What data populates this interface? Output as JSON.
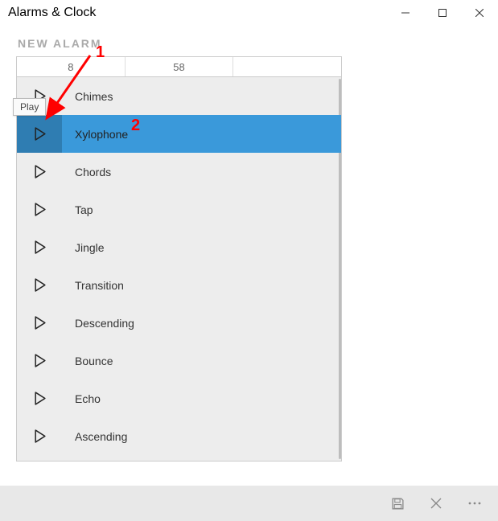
{
  "titlebar": {
    "title": "Alarms & Clock"
  },
  "page": {
    "header": "NEW ALARM"
  },
  "time": {
    "hour": "8",
    "minute": "58",
    "blank": ""
  },
  "tooltip": {
    "play": "Play"
  },
  "sounds": {
    "items": [
      {
        "label": "Chimes"
      },
      {
        "label": "Xylophone"
      },
      {
        "label": "Chords"
      },
      {
        "label": "Tap"
      },
      {
        "label": "Jingle"
      },
      {
        "label": "Transition"
      },
      {
        "label": "Descending"
      },
      {
        "label": "Bounce"
      },
      {
        "label": "Echo"
      },
      {
        "label": "Ascending"
      }
    ],
    "selected_index": 1
  },
  "annotations": {
    "num1": "1",
    "num2": "2"
  }
}
